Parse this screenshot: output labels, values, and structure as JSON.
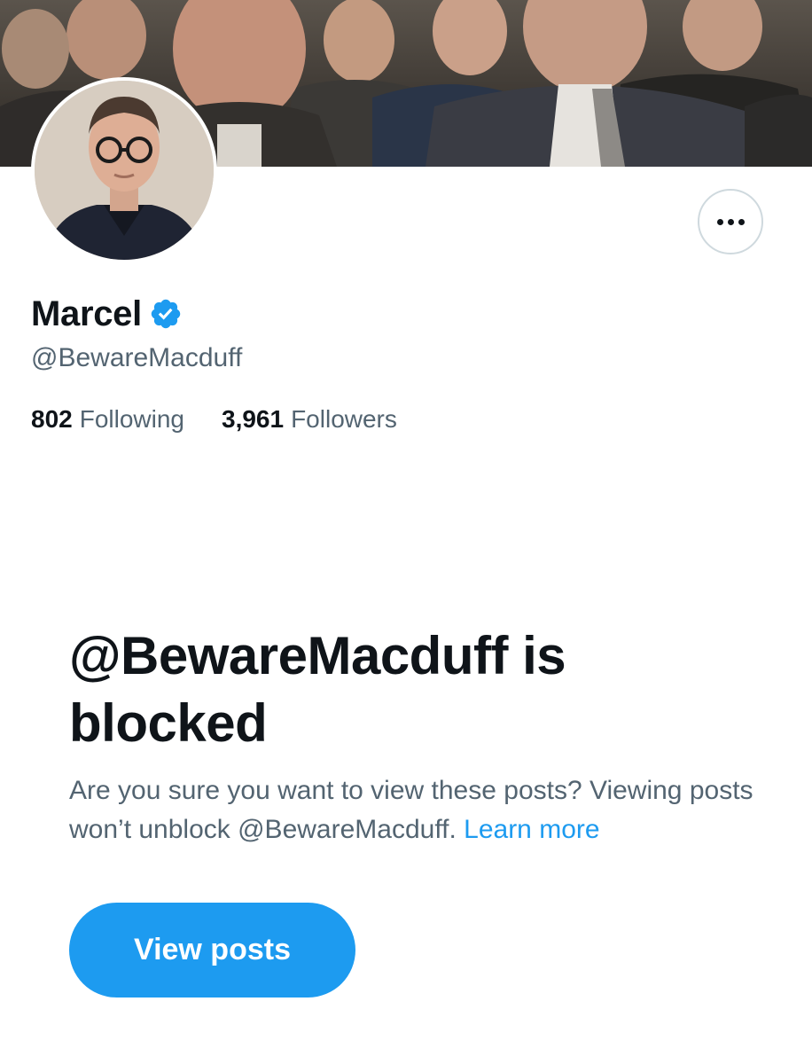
{
  "profile": {
    "display_name": "Marcel",
    "verified": true,
    "handle": "@BewareMacduff",
    "following_count": "802",
    "following_label": "Following",
    "followers_count": "3,961",
    "followers_label": "Followers"
  },
  "icons": {
    "verified": "verified-badge-icon",
    "more": "more-options-icon"
  },
  "blocked": {
    "title": "@BewareMacduff is blocked",
    "description": "Are you sure you want to view these posts? Viewing posts won’t unblock @BewareMacduff.",
    "learn_more_label": "Learn more",
    "button_label": "View posts"
  },
  "colors": {
    "accent": "#1d9bf0",
    "text_primary": "#0f1419",
    "text_secondary": "#536471",
    "border": "#cfd9de"
  }
}
